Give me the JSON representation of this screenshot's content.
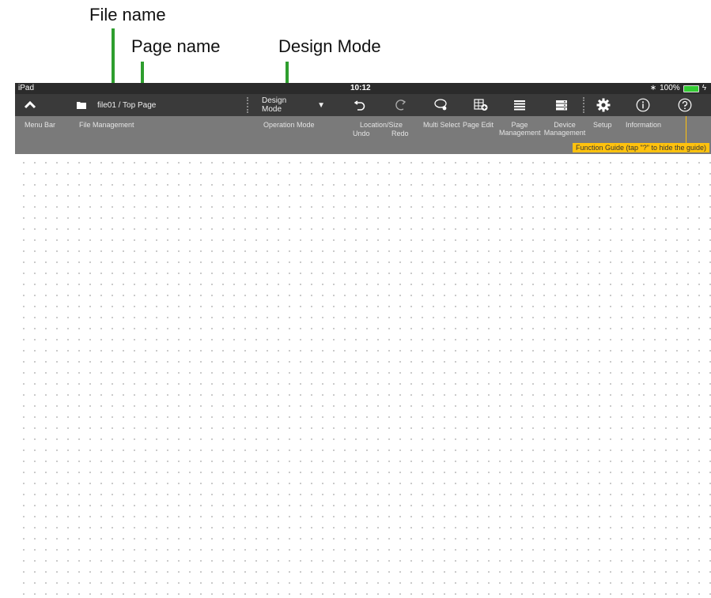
{
  "callouts": {
    "file_name": "File name",
    "page_name": "Page name",
    "design_mode": "Design Mode"
  },
  "statusbar": {
    "carrier": "iPad",
    "time": "10:12",
    "battery": "100%",
    "battery_level": 1.0,
    "battery_color": "#33cc33"
  },
  "toolbar": {
    "file_path": "file01 / Top Page",
    "mode_label": "Design Mode",
    "icons": [
      "chevron-up-icon",
      "folder-icon",
      "undo-icon",
      "redo-icon",
      "lasso-icon",
      "page-add-icon",
      "list-icon",
      "device-icon",
      "gear-icon",
      "info-icon",
      "help-icon"
    ]
  },
  "guide": {
    "menu_bar": "Menu Bar",
    "file_management": "File Management",
    "operation_mode": "Operation Mode",
    "location_size": "Location/Size",
    "undo": "Undo",
    "redo": "Redo",
    "multi_select": "Multi Select",
    "page_edit": "Page Edit",
    "page_management": "Page Management",
    "device_management": "Device Management",
    "setup": "Setup",
    "information": "Information",
    "function_guide": "Function Guide (tap \"?\" to hide the guide)"
  },
  "colors": {
    "toolbar_bg": "#3a3a3a",
    "guide_bg": "#7a7a7a",
    "guide_banner": "#ffc20e",
    "callout_pointer": "#2e9e2e"
  }
}
